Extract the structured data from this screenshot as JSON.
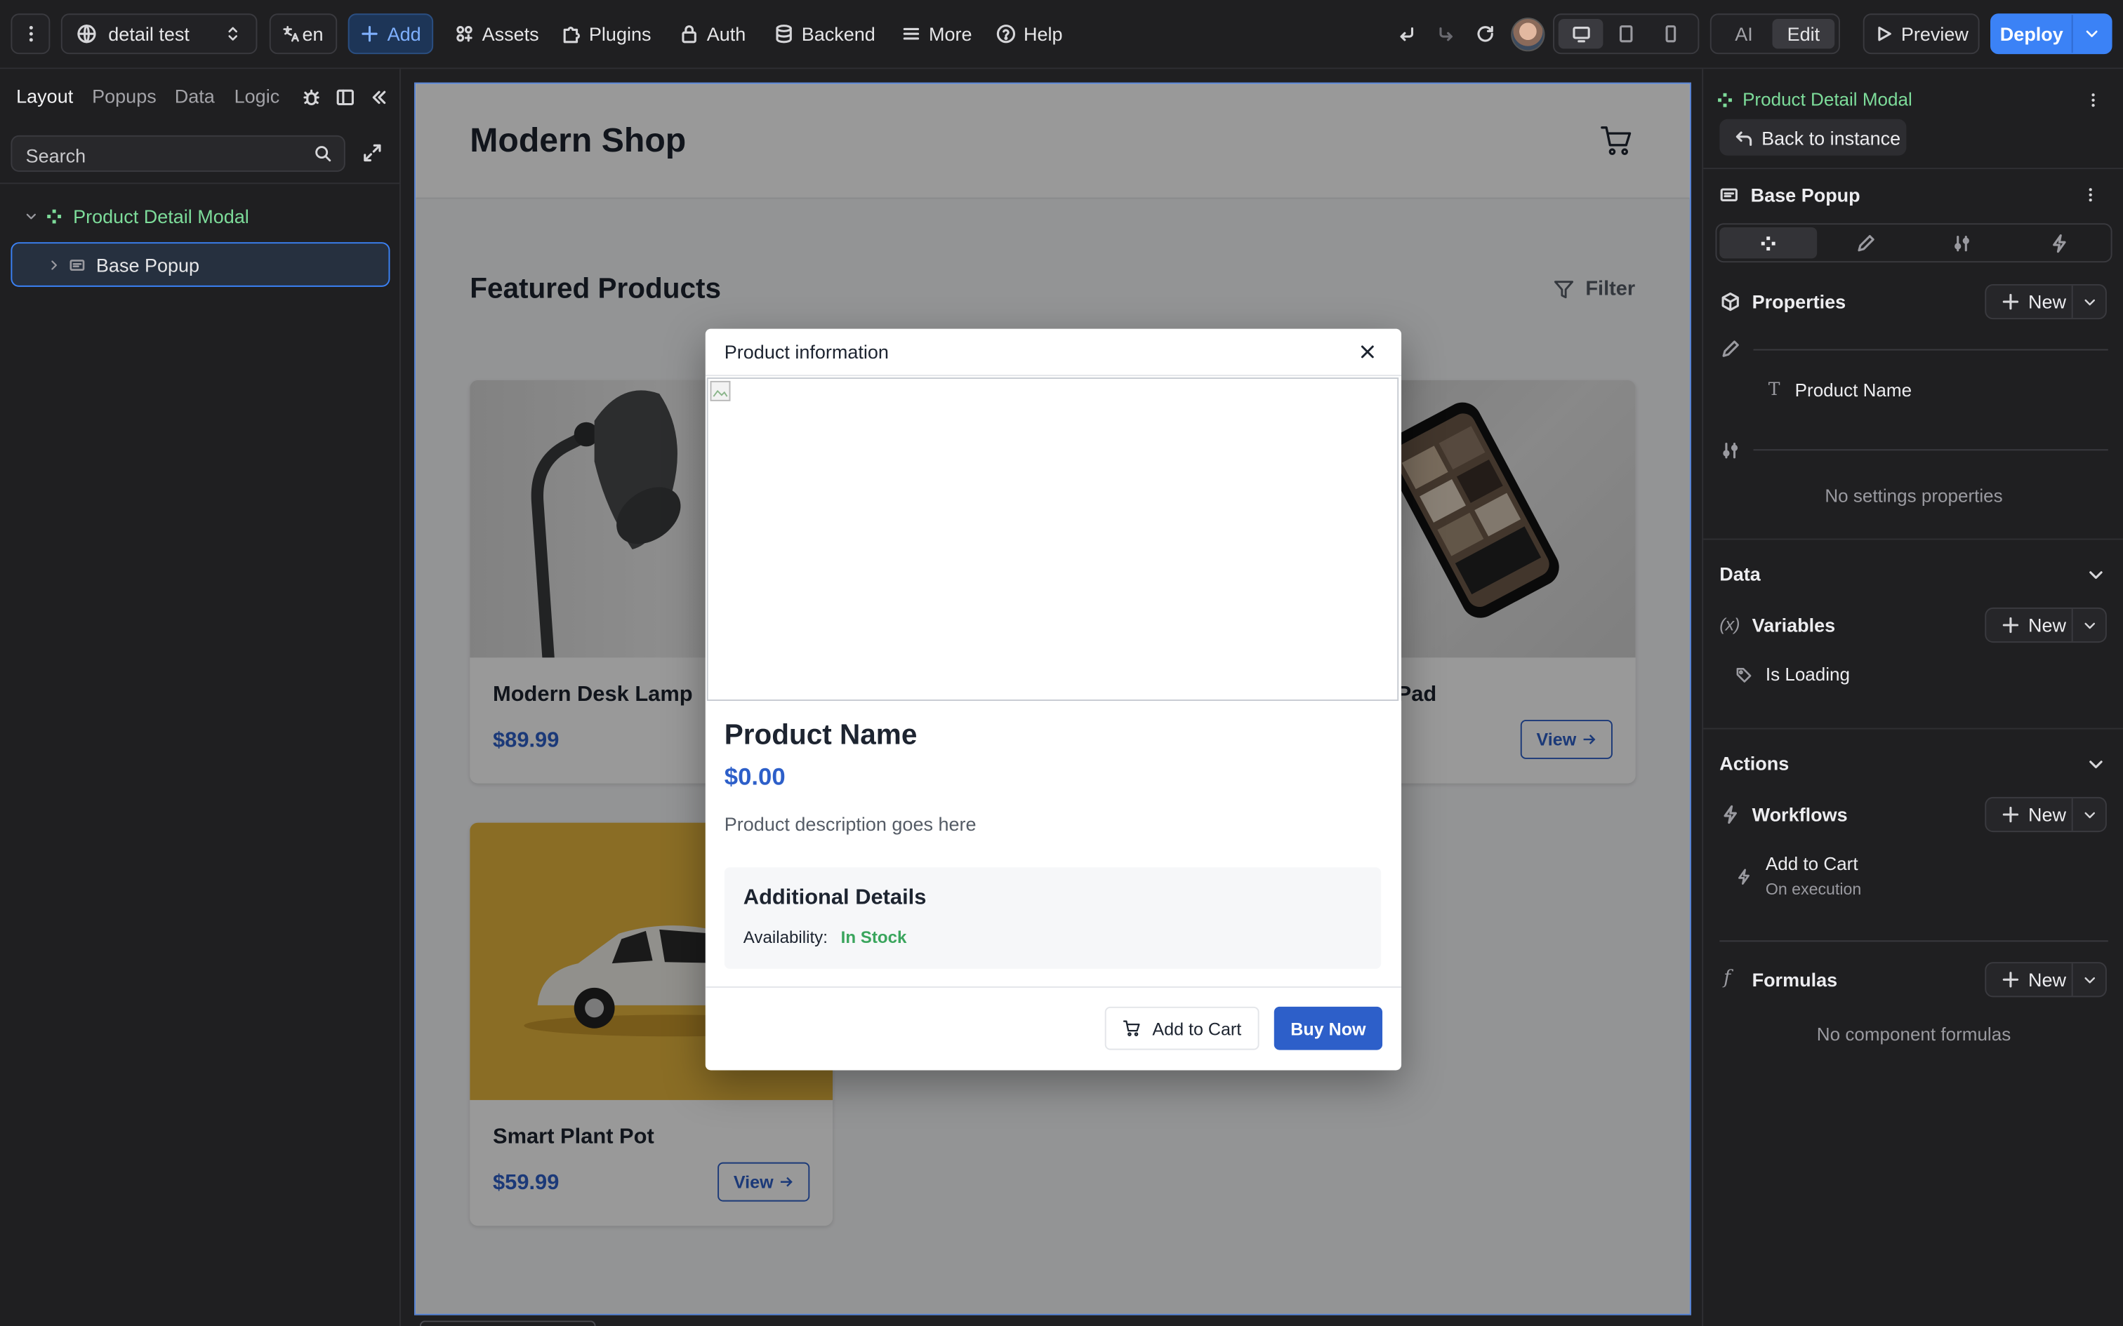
{
  "topbar": {
    "project_name": "detail test",
    "language": "en",
    "add_label": "Add",
    "assets_label": "Assets",
    "plugins_label": "Plugins",
    "auth_label": "Auth",
    "backend_label": "Backend",
    "more_label": "More",
    "help_label": "Help",
    "ai_label": "AI",
    "edit_label": "Edit",
    "preview_label": "Preview",
    "deploy_label": "Deploy"
  },
  "left_panel": {
    "tabs": [
      "Layout",
      "Popups",
      "Data",
      "Logic"
    ],
    "active_tab": "Layout",
    "search_placeholder": "Search",
    "tree": {
      "root": "Product Detail Modal",
      "child": "Base Popup"
    }
  },
  "canvas": {
    "shop_title": "Modern Shop",
    "section_title": "Featured Products",
    "filter_label": "Filter",
    "products": [
      {
        "name": "Modern Desk Lamp",
        "price": "$89.99"
      },
      {
        "name": "Charging Pad",
        "price": "",
        "view_label": "View"
      },
      {
        "name": "Smart Plant Pot",
        "price": "$59.99",
        "view_label": "View"
      }
    ],
    "modal": {
      "title": "Product information",
      "product_name": "Product Name",
      "price": "$0.00",
      "description": "Product description goes here",
      "details_title": "Additional Details",
      "availability_label": "Availability:",
      "availability_value": "In Stock",
      "add_to_cart_label": "Add to Cart",
      "buy_now_label": "Buy Now"
    }
  },
  "right_panel": {
    "component_name": "Product Detail Modal",
    "back_label": "Back to instance",
    "element_name": "Base Popup",
    "properties_title": "Properties",
    "new_label": "New",
    "property_item": "Product Name",
    "no_settings": "No settings properties",
    "data_title": "Data",
    "variables_title": "Variables",
    "variable_item": "Is Loading",
    "actions_title": "Actions",
    "workflows_title": "Workflows",
    "workflow_name": "Add to Cart",
    "workflow_trigger": "On execution",
    "formulas_title": "Formulas",
    "no_formulas": "No component formulas"
  },
  "colors": {
    "accent_blue": "#2d5fc9",
    "component_green": "#7ddc9a",
    "in_stock_green": "#3aa55d",
    "deploy_blue": "#3b82f6"
  }
}
